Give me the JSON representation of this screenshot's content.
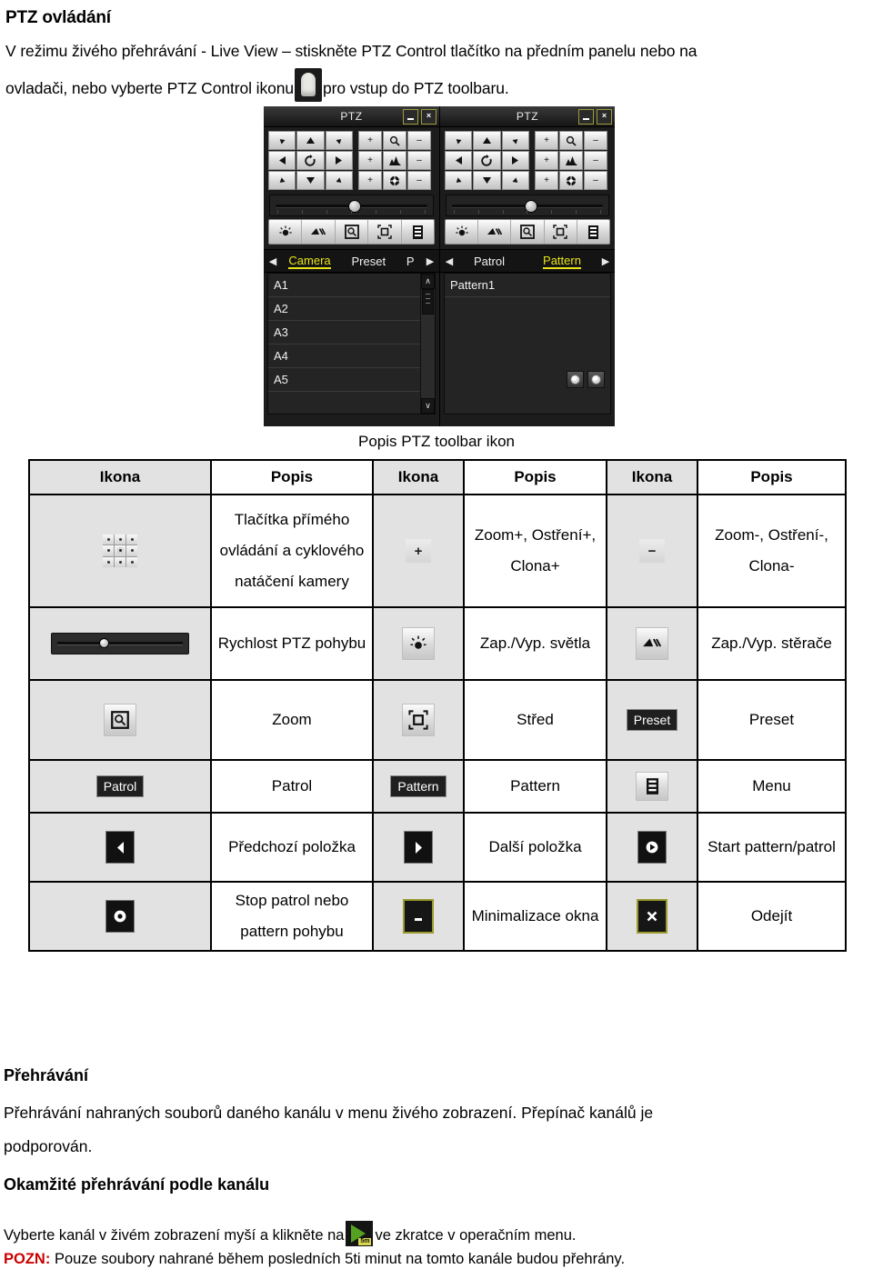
{
  "document": {
    "title": "PTZ ovládání",
    "intro_line1": "V režimu živého přehrávání - Live View – stiskněte PTZ Control tlačítko na předním panelu  nebo na",
    "intro_line2_before": "ovladači, nebo vyberte PTZ Control ikonu",
    "intro_line2_after": "pro vstup do PTZ toolbaru."
  },
  "ptz_screenshot": {
    "left_panel": {
      "title": "PTZ",
      "minimize_label": "–",
      "close_label": "×",
      "direction_buttons": [
        "up-left",
        "up",
        "up-right",
        "left",
        "auto-cycle",
        "right",
        "down-left",
        "down",
        "down-right"
      ],
      "zoom_focus_buttons": [
        "+",
        "zoom",
        "−",
        "+",
        "focus",
        "−",
        "+",
        "iris",
        "−"
      ],
      "toolbar_icons": [
        "light-icon",
        "wiper-icon",
        "zoom-icon",
        "center-icon",
        "menu-icon"
      ],
      "tabs": [
        "Camera",
        "Preset",
        "P"
      ],
      "active_tab": "Camera",
      "list_items": [
        "A1",
        "A2",
        "A3",
        "A4",
        "A5"
      ]
    },
    "right_panel": {
      "title": "PTZ",
      "minimize_label": "–",
      "close_label": "×",
      "toolbar_icons": [
        "light-icon",
        "wiper-icon",
        "zoom-icon",
        "center-icon",
        "menu-icon"
      ],
      "tabs": [
        "Patrol",
        "Pattern"
      ],
      "active_tab": "Pattern",
      "list_items": [
        "Pattern1"
      ]
    }
  },
  "table": {
    "caption": "Popis  PTZ toolbar ikon",
    "headers": [
      "Ikona",
      "Popis",
      "Ikona",
      "Popis",
      "Ikona",
      "Popis"
    ],
    "rows": [
      {
        "c1_icon": "dpad-icon",
        "c1_desc": "Tlačítka přímého ovládání a cyklového natáčení kamery",
        "c2_icon": "plus-icon",
        "c2_icon_label": "+",
        "c2_desc": "Zoom+, Ostření+, Clona+",
        "c3_icon": "minus-icon",
        "c3_icon_label": "−",
        "c3_desc": "Zoom-, Ostření-, Clona-"
      },
      {
        "c1_icon": "speed-slider-icon",
        "c1_desc": "Rychlost PTZ pohybu",
        "c2_icon": "light-icon",
        "c2_desc": "Zap./Vyp. světla",
        "c3_icon": "wiper-icon",
        "c3_desc": "Zap./Vyp. stěrače"
      },
      {
        "c1_icon": "zoom-icon",
        "c1_desc": "Zoom",
        "c2_icon": "center-icon",
        "c2_desc": "Střed",
        "c3_icon": "preset-icon",
        "c3_icon_label": "Preset",
        "c3_desc": "Preset"
      },
      {
        "c1_icon": "patrol-icon",
        "c1_icon_label": "Patrol",
        "c1_desc": "Patrol",
        "c2_icon": "pattern-icon",
        "c2_icon_label": "Pattern",
        "c2_desc": "Pattern",
        "c3_icon": "menu-icon",
        "c3_desc": "Menu"
      },
      {
        "c1_icon": "previous-icon",
        "c1_desc": "Předchozí položka",
        "c2_icon": "next-icon",
        "c2_desc": "Další položka",
        "c3_icon": "start-icon",
        "c3_desc": "Start pattern/patrol"
      },
      {
        "c1_icon": "stop-icon",
        "c1_desc": "Stop patrol nebo pattern pohybu",
        "c2_icon": "minimize-icon",
        "c2_desc": "Minimalizace okna",
        "c3_icon": "exit-icon",
        "c3_desc": "Odejít"
      }
    ]
  },
  "playback": {
    "heading": "Přehrávání",
    "paragraph_line1": "Přehrávání nahraných souborů daného kanálu v menu živého zobrazení. Přepínač kanálů je",
    "paragraph_line2": "podporován.",
    "subheading": "Okamžité přehrávání podle kanálu",
    "instruction_before": "Vyberte kanál v živém  zobrazení myší a klikněte na",
    "instruction_after": "ve zkratce v operačním menu.",
    "note_label": "POZN:",
    "note_text": "Pouze soubory nahrané během posledních 5ti minut na tomto kanále budou přehrány.",
    "play_icon_badge": "5m"
  },
  "colors": {
    "accent_yellow": "#e8e416",
    "note_red": "#cc0000",
    "icon_cell_bg": "#e2e2e2",
    "panel_bg": "#1c1c1c"
  }
}
